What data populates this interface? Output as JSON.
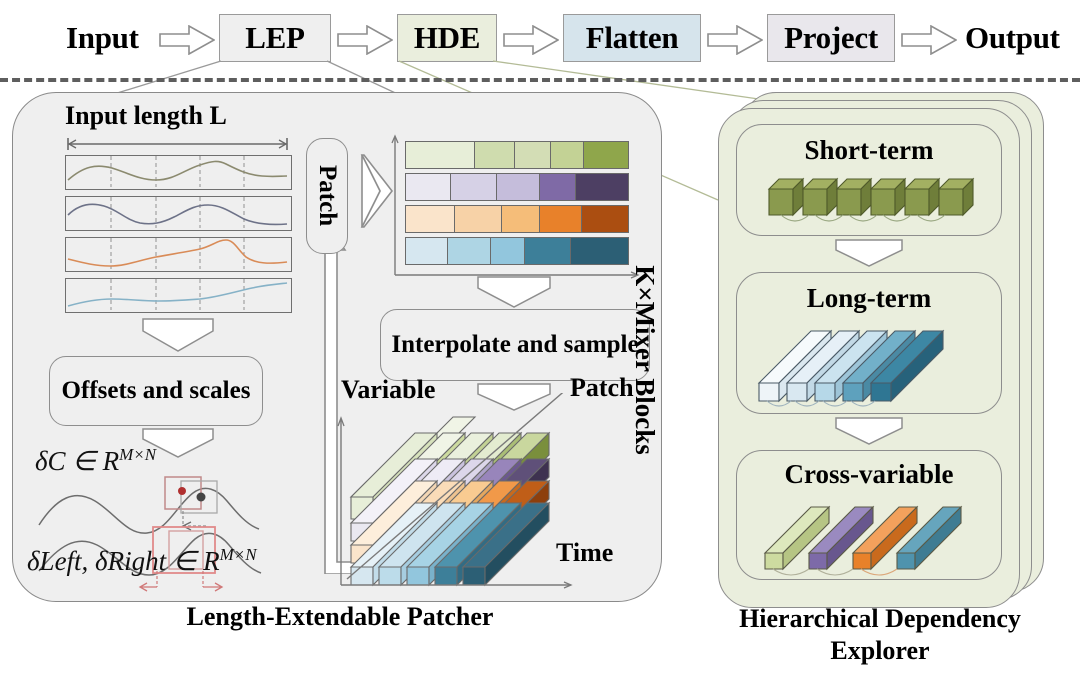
{
  "figure": {
    "title": "Length-Extendable Patcher and Hierarchical Dependency Explorer architecture"
  },
  "pipeline": {
    "input_label": "Input",
    "output_label": "Output",
    "stages": [
      {
        "id": "lep",
        "label": "LEP",
        "fill": "#efefef",
        "border": "#9a9a9a"
      },
      {
        "id": "hde",
        "label": "HDE",
        "fill": "#eaeedd",
        "border": "#9a9a9a"
      },
      {
        "id": "flatten",
        "label": "Flatten",
        "fill": "#d6e4ec",
        "border": "#9a9a9a"
      },
      {
        "id": "project",
        "label": "Project",
        "fill": "#e9e7ec",
        "border": "#9a9a9a"
      }
    ],
    "arrow_count": 5
  },
  "left_panel": {
    "caption": "Length-Extendable Patcher",
    "input_length_label": "Input length L",
    "series_count": 4,
    "segment_dividers": 4,
    "series_colors": [
      "#8b8a6f",
      "#6d7288",
      "#d98b57",
      "#86b2c7"
    ],
    "offsets_box": "Offsets and scales",
    "patch_box": "Patch",
    "interpolate_box": "Interpolate and sample",
    "math": {
      "delta_c": "δC ∈ R",
      "delta_c_sup": "M×N",
      "delta_lr": "δLeft, δRight ∈ R",
      "delta_lr_sup": "M×N"
    },
    "patch_rows": [
      {
        "name": "green",
        "cells": [
          "#e7eed8",
          "#cfdcae",
          "#d3ddb5",
          "#c3d295",
          "#8fa64b"
        ]
      },
      {
        "name": "purple",
        "cells": [
          "#eae8f1",
          "#d6d1e6",
          "#c5bddb",
          "#7f6aa6",
          "#4d3f63"
        ]
      },
      {
        "name": "orange",
        "cells": [
          "#fae4cb",
          "#f7d2a7",
          "#f5bd79",
          "#e8812a",
          "#ab4e11"
        ]
      },
      {
        "name": "blue",
        "cells": [
          "#d6e7f0",
          "#aed5e4",
          "#92c6dd",
          "#3d7f99",
          "#2c5f75"
        ]
      }
    ],
    "cube_axes": {
      "variable": "Variable",
      "patch": "Patch",
      "time": "Time"
    },
    "cube_grid": {
      "rows": 4,
      "cols": 5,
      "row_colors": [
        [
          "#e7eed8",
          "#dfe8c9",
          "#d3ddb5",
          "#c3d295",
          "#8fa64b"
        ],
        [
          "#eae8f1",
          "#ddd8ea",
          "#c5bddb",
          "#7f6aa6",
          "#4d3f63"
        ],
        [
          "#fae4cb",
          "#f7d2a7",
          "#f5bd79",
          "#e8812a",
          "#ab4e11"
        ],
        [
          "#d6e7f0",
          "#bcdcea",
          "#92c6dd",
          "#3d7f99",
          "#2c5f75"
        ]
      ]
    }
  },
  "right_panel": {
    "caption_line1": "Hierarchical Dependency",
    "caption_line2": "Explorer",
    "repeat_label": "K×Mixer Blocks",
    "stack_layers": 3,
    "panel_fill": "#eaeedd",
    "blocks": [
      {
        "id": "short-term",
        "label": "Short-term",
        "shape": "cubes",
        "count": 6,
        "color": "#8a9a4e",
        "top": "#a3b062",
        "side": "#6f7e3a"
      },
      {
        "id": "long-term",
        "label": "Long-term",
        "shape": "bars",
        "count": 5,
        "colors": [
          "#eef4f8",
          "#d9e8f1",
          "#b6d8e8",
          "#5ea1bd",
          "#2f7693"
        ]
      },
      {
        "id": "cross-variable",
        "label": "Cross-variable",
        "shape": "bars",
        "count": 4,
        "colors": [
          "#cddba0",
          "#7d6aa8",
          "#e8812a",
          "#4f93ad"
        ]
      }
    ]
  }
}
